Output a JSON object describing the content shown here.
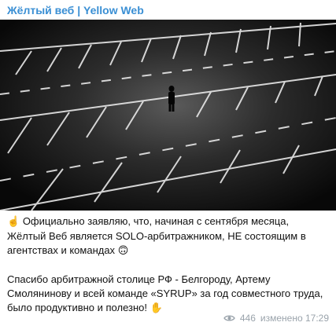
{
  "channel": {
    "title": "Жёлтый веб | Yellow Web"
  },
  "post": {
    "lead_emoji": "☝️",
    "paragraph1": "Официально заявляю, что, начиная с сентября месяца, Жёлтый Веб является SOLO-арбитражником, НЕ состоящим в агентствах и командах",
    "paragraph1_emoji": "🙃",
    "paragraph2": "Спасибо арбитражной столице РФ - Белгороду, Артему Смолянинову и всей команде «SYRUP» за год совместного труда, было продуктивно и полезно!",
    "paragraph2_emoji": "✋"
  },
  "meta": {
    "views": "446",
    "edited": "изменено 17:29",
    "view_icon": "eye-icon"
  },
  "colors": {
    "channel_title": "#3a8fd4",
    "meta": "#9aa3ab"
  }
}
